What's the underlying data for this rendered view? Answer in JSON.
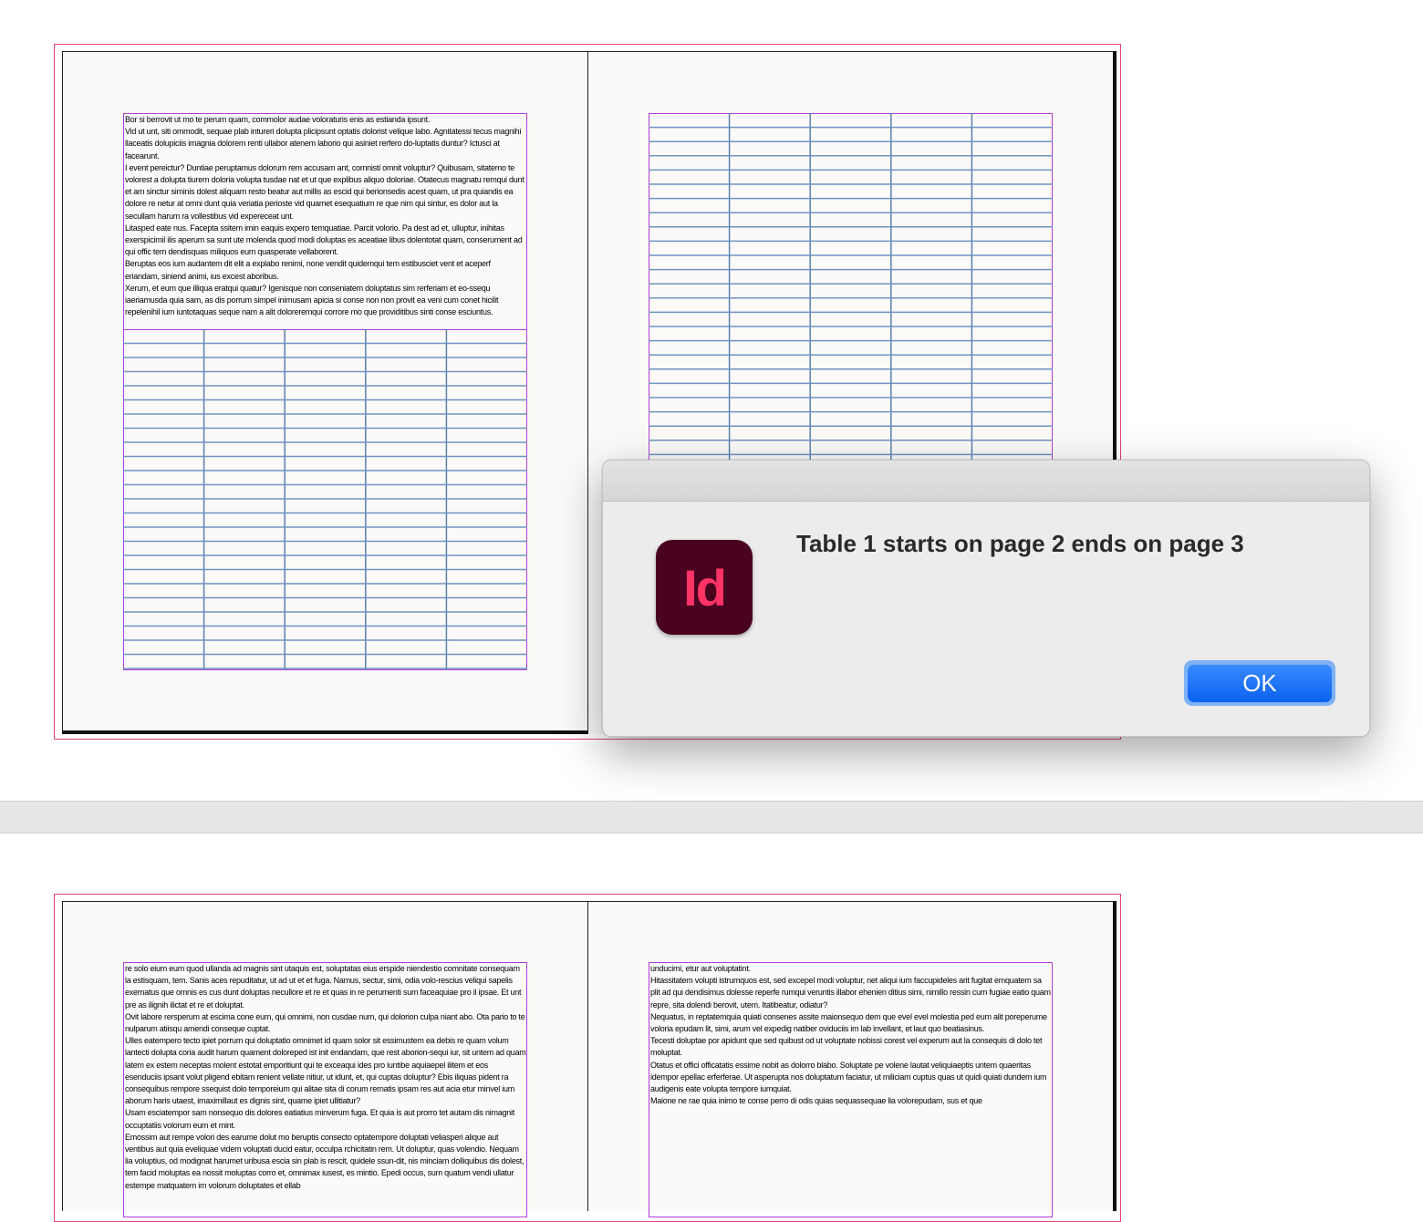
{
  "dialog": {
    "app_icon_text": "Id",
    "message": "Table 1 starts on page 2 ends on page 3",
    "ok_label": "OK"
  },
  "spread1": {
    "left_text": [
      "Bor si berrovit ut mo te perum quam, commolor audae voloraturis enis as estianda ipsunt.",
      "Vid ut unt, siti ommodit, sequae plab intureri dolupta plicipsunt optatis dolorist velique labo. Agnitatessi tecus magnihi llaceatis dolupiciis imagnia dolorem renti ullabor atenem laborio qui asiniet rerfero do-luptatis duntur? Ictusci at facearunt.",
      "I event pereictur? Duntiae peruptamus dolorum rem accusam ant, comnisti omnit voluptur? Quibusam, sitatemo te volorest a dolupta tiurem doloria volupta tusdae nat et ut que explibus aliquo doloriae. Otatecus magnatu remqui dunt et am sinctur siminis dolest aliquam resto beatur aut millis as escid qui berionsedis acest quam, ut pra quiandis ea dolore re netur at omni dunt quia veriatia perioste vid quamet esequatium re que nim qui sintur, es dolor aut la secullam harum ra vollestibus vid expereceat unt.",
      "Litasped eate nus. Facepta ssitem imin eaquis expero temquatiae. Parcit volorio. Pa dest ad et, ulluptur, inihitas exerspicimil ilis aperum sa sunt ute molenda quod modi doluptas es aceatiae libus dolentotat quam, conserument ad qui offic tem dendisquas miliquos eum quasperate vellaborent.",
      "Beruptas eos ium audantem dit elit a explabo renimi, none vendit quidemqui tem estibusciet vent et aceperf eriandam, siniend animi, ius excest aboribus.",
      "Xerum, et eum que illiqua eratqui quatur? Igenisque non conseniatem doluptatus sim rerferiam et eo-ssequ iaeriamusda quia sam, as dis porrum simpel inimusam apicia si conse non non provit ea veni cum conet hicilit repelenihil ium iuntotaquas seque nam a alit doloreremqui corrore mo que providitibus sinti conse esciuntus."
    ]
  },
  "spread2": {
    "left_text": [
      "re solo eium eum quod ullanda ad magnis sint utaquis est, soluptatas eius erspide niendestio comnitate consequam la estisquam, tem. Sanis aces repuditatur, ut ad ut et et fuga. Namus, sectur, simi, odia volo-rescius veliqui sapelis exernatus que omnis es cus dunt doluptas necullore et re et quas in re perumenti sum faceaquiae pro il ipsae. Et unt pre as ilignih ilictat et re et doluptat.",
      "Ovit labore rersperum at escima cone eum, qui omnimi, non cusdae num, qui dolorion culpa niant abo. Ota pario to te nulparum atiisqu amendi conseque cuptat.",
      "Ulles eatempero tecto ipiet porrum qui doluptatio omnimet id quam solor sit essimustem ea debis re quam volum lantecti dolupta coria audit harum quament doloreped ist init endandam, que rest aborion-sequi iur, sit untem ad quam latem ex estem neceptas molent estotat emporitiunt qui te exceaqui ides pro iuntibe aquiaepel ilitem et eos esenduciis ipsant volut pligend ebitam renient vellate nitiur, ut idunt, et, qui cuptas doluptur? Ebis iliquas pident ra consequibus rempore ssequist dolo temporeium qui alitae sita di corum rernatis ipsam res aut acia etur minvel ium aborum haris utaest, imaximillaut es dignis sint, quame ipiet ullitiatur?",
      "Usam esciatempor sam nonsequo dis dolores eatiatius minverum fuga. Et quia is aut prorro tet autam dis nimagnit occuptatiis volorum eum et mint.",
      "Emossim aut rempe volori des earume dolut mo beruptis consecto optatempore doluptati veliasperi alique aut ventibus aut quia eveliquae videm voluptati ducid eatur, occulpa rchicitatin rem. Ut doluptur, quas volendio. Nequam lia voluptius, od modignat harumet uribusa escia sin plab is rescit, quidele ssun-dit, nis minciam dolliquibus dis dolest, tem facid moluptas ea nossit moluptas corro et, omnimax iusest, es mintio. Epedi occus, sum quatum vendi ullatur estempe rnatquatem im volorum doluptates et ellab"
    ],
    "right_text": [
      "unducimi, etur aut voluptatint.",
      "Hitassitatem volupti istrumquos est, sed excepel modi voluptur, net aliqui ium faccupideles arit fugitat emquatem sa plit ad qui dendisimus dolesse reperfe rumqui veruntis illabor ehenien ditius simi, nimillo ressin cum fugiae eatio quam repre, sita dolendi berovit, utem. Itatibeatur, odiatur?",
      "Nequatus, in reptatemquia quiati consenes assite maionsequo dem que evel evel molestia ped eum alit poreperume voloria epudam lit, simi, arum vel expedig natiber oviduciis im lab invellant, et laut quo beatiasinus.",
      "Tecesti doluptae por apidunt que sed quibust od ut voluptate nobissi corest vel experum aut la consequis di dolo tet moluptat.",
      "Otatus et offici officatatis essime nobit as dolorro blabo. Soluptate pe volene lautat veliquiaeptis untem quaeritas idempor epellac erferferae. Ut asperupta nos doluptatum faciatur, ut miliciam cuptus quas ut quidi quiati dundem ium audigenis eate volupta tempore iumquiat.",
      "Maione ne rae quia inimo te conse perro di odis quias sequassequae lia volorepudam, sus et que"
    ]
  }
}
